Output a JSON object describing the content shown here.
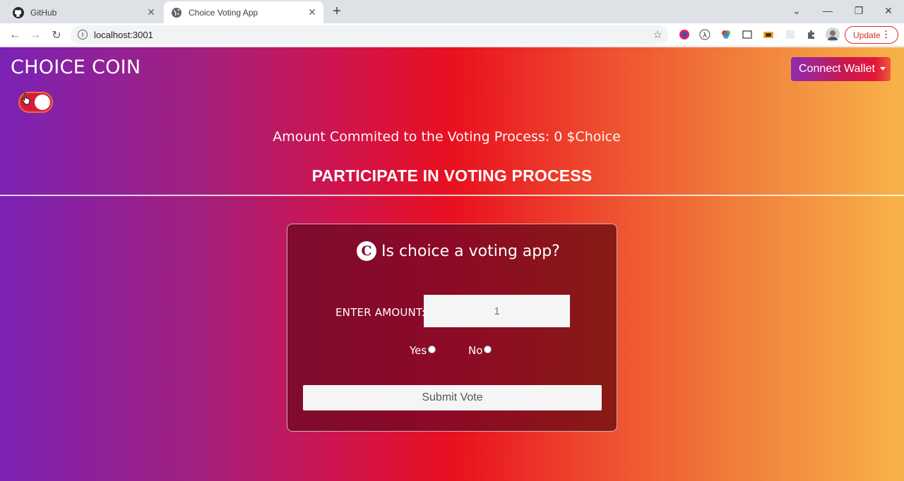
{
  "browser": {
    "tabs": [
      {
        "title": "GitHub",
        "favicon": "github-icon"
      },
      {
        "title": "Choice Voting App",
        "favicon": "globe-icon"
      }
    ],
    "url": "localhost:3001",
    "update_label": "Update"
  },
  "header": {
    "brand": "CHOICE COIN",
    "connect_wallet": "Connect Wallet",
    "toggle_on": true
  },
  "amount_committed": "Amount Commited to the Voting Process: 0 $Choice",
  "section_title": "PARTICIPATE IN VOTING PROCESS",
  "card": {
    "coin_glyph": "C",
    "question": "Is choice a voting app?",
    "amount_label": "ENTER AMOUNT:",
    "amount_placeholder": "1",
    "options": [
      "Yes",
      "No"
    ],
    "submit_label": "Submit Vote"
  },
  "colors": {
    "gradient": [
      "#7b22b4",
      "#e9101f",
      "#f8b34a"
    ],
    "card": "#8c0a26"
  }
}
